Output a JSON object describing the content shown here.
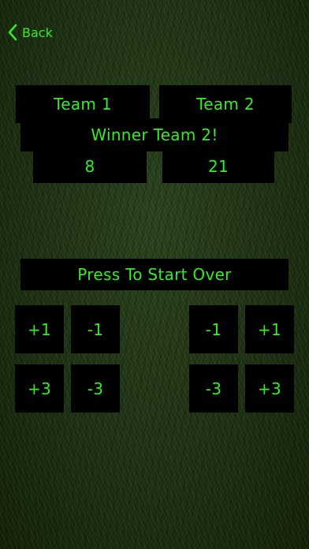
{
  "nav": {
    "back_label": "Back"
  },
  "teams": {
    "team1_label": "Team 1",
    "team2_label": "Team 2"
  },
  "result": {
    "winner_text": "Winner Team 2!"
  },
  "scores": {
    "team1": "8",
    "team2": "21"
  },
  "actions": {
    "start_over_label": "Press To Start Over"
  },
  "controls": {
    "team1": {
      "plus1": "+1",
      "minus1": "-1",
      "plus3": "+3",
      "minus3": "-3"
    },
    "team2": {
      "minus1": "-1",
      "plus1": "+1",
      "minus3": "-3",
      "plus3": "+3"
    }
  },
  "colors": {
    "accent": "#33ee22",
    "panel": "#000000",
    "background": "#1f3316"
  }
}
